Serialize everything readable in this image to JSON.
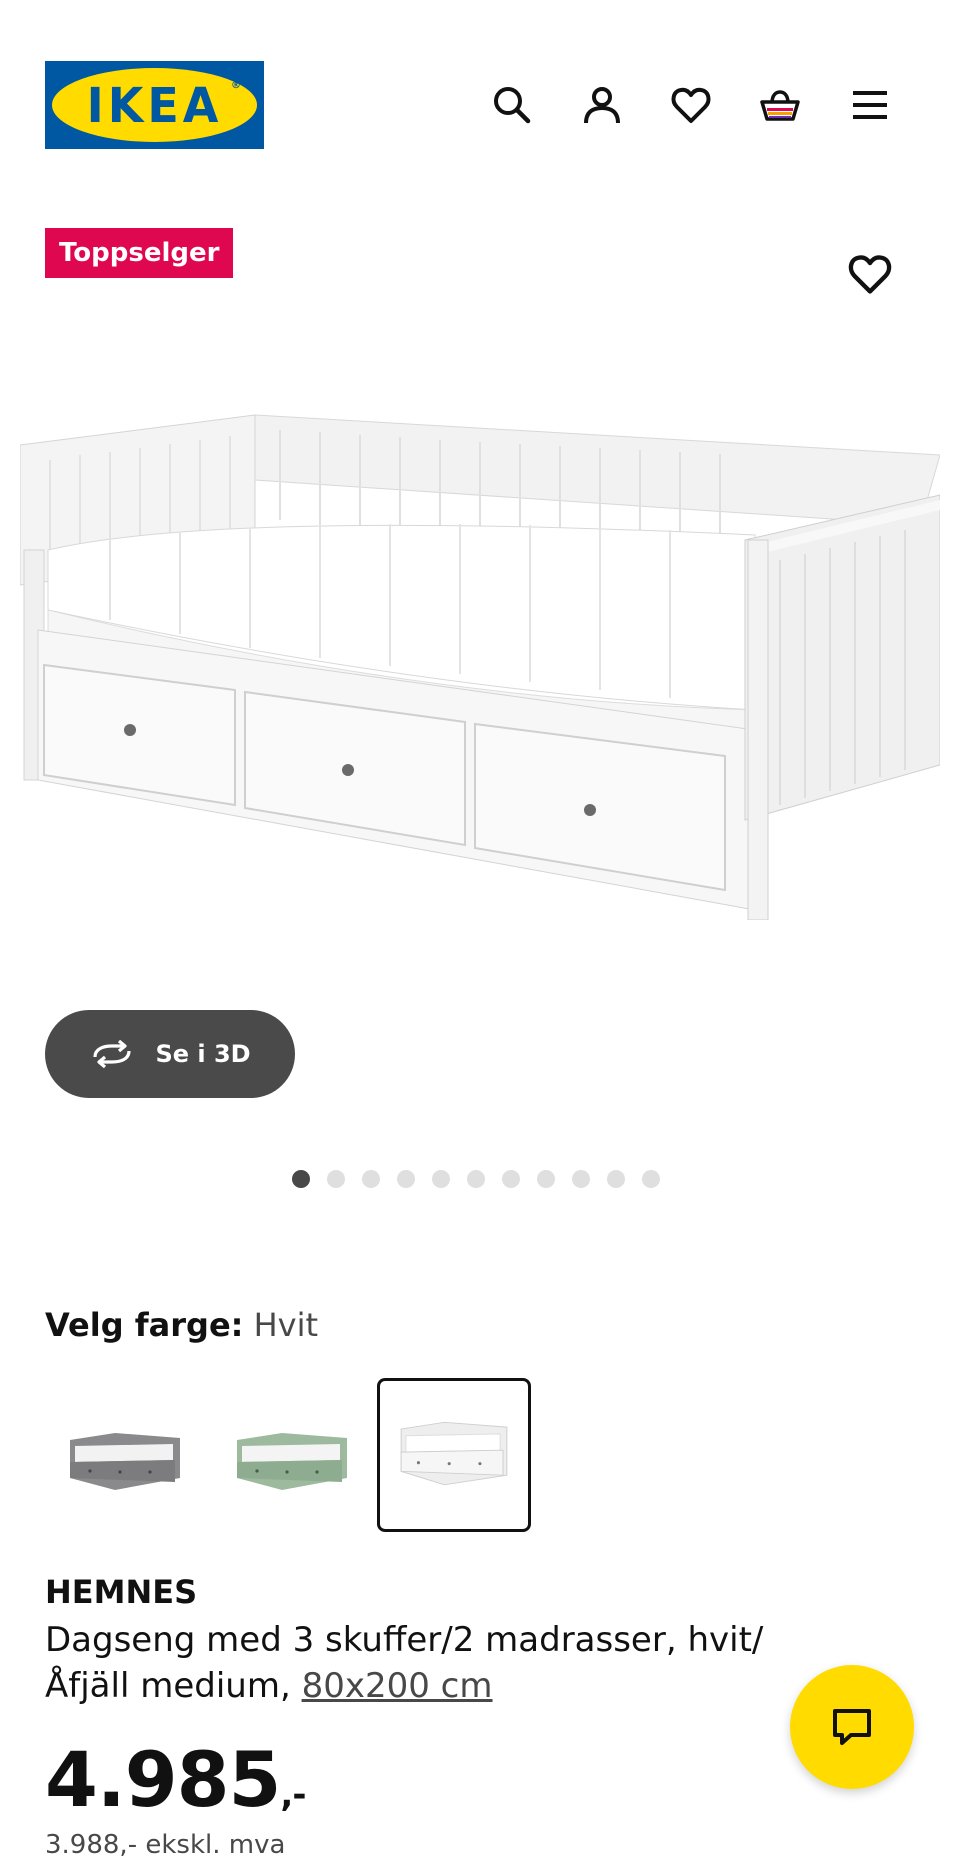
{
  "header": {
    "logo_text": "IKEA",
    "logo_mark": "®",
    "icons": [
      "search-icon",
      "account-icon",
      "heart-icon",
      "cart-icon",
      "menu-icon"
    ]
  },
  "badge": {
    "label": "Toppselger"
  },
  "viewer": {
    "button_3d_label": "Se i 3D",
    "image_count": 11,
    "active_index": 0
  },
  "color": {
    "label": "Velg farge:",
    "value": "Hvit",
    "swatches": [
      "grey",
      "green",
      "white"
    ],
    "selected_index": 2
  },
  "product": {
    "name": "HEMNES",
    "description": "Dagseng med 3 skuffer/2 madrasser, hvit/Åfjäll medium,",
    "size": "80x200 cm",
    "price_main": "4.985",
    "price_suffix": ",-",
    "price_ex_vat": "3.988,- ekskl. mva"
  },
  "colors": {
    "brand_blue": "#0058a3",
    "brand_yellow": "#ffdb00",
    "badge_red": "#e00751",
    "button_dark": "#4a4a4a"
  }
}
